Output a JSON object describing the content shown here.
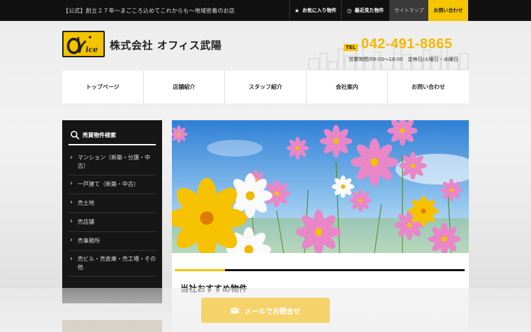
{
  "topbar": {
    "tagline": "【公式】創立２７年〜まごころ込めてこれからも〜地域密着のお店",
    "links": {
      "favorites": "お気に入り物件",
      "recent": "最近見た物件",
      "sitemap": "サイトマップ",
      "contact": "お問い合わせ"
    }
  },
  "header": {
    "logo_text": "Office",
    "company": "株式会社 オフィス武陽",
    "tel_label": "TEL",
    "tel": "042-491-8865",
    "hours": "営業時間/09:00～18:00　定休日/火曜日・水曜日"
  },
  "nav": [
    {
      "label": "トップページ"
    },
    {
      "label": "店舗紹介"
    },
    {
      "label": "スタッフ紹介"
    },
    {
      "label": "会社案内"
    },
    {
      "label": "お問い合わせ"
    }
  ],
  "sidebar": {
    "title": "売買物件検索",
    "items": [
      {
        "label": "マンション（新築・分譲・中古）"
      },
      {
        "label": "一戸建て（新築・中古）"
      },
      {
        "label": "売土地"
      },
      {
        "label": "売店舗"
      },
      {
        "label": "売事務所"
      },
      {
        "label": "売ビル・売倉庫・売工場・その他"
      }
    ]
  },
  "main": {
    "section_title": "当社おすすめ物件"
  },
  "floating": {
    "mail_button": "メールでお問合せ"
  },
  "colors": {
    "accent": "#f5c400",
    "dark": "#111111"
  }
}
